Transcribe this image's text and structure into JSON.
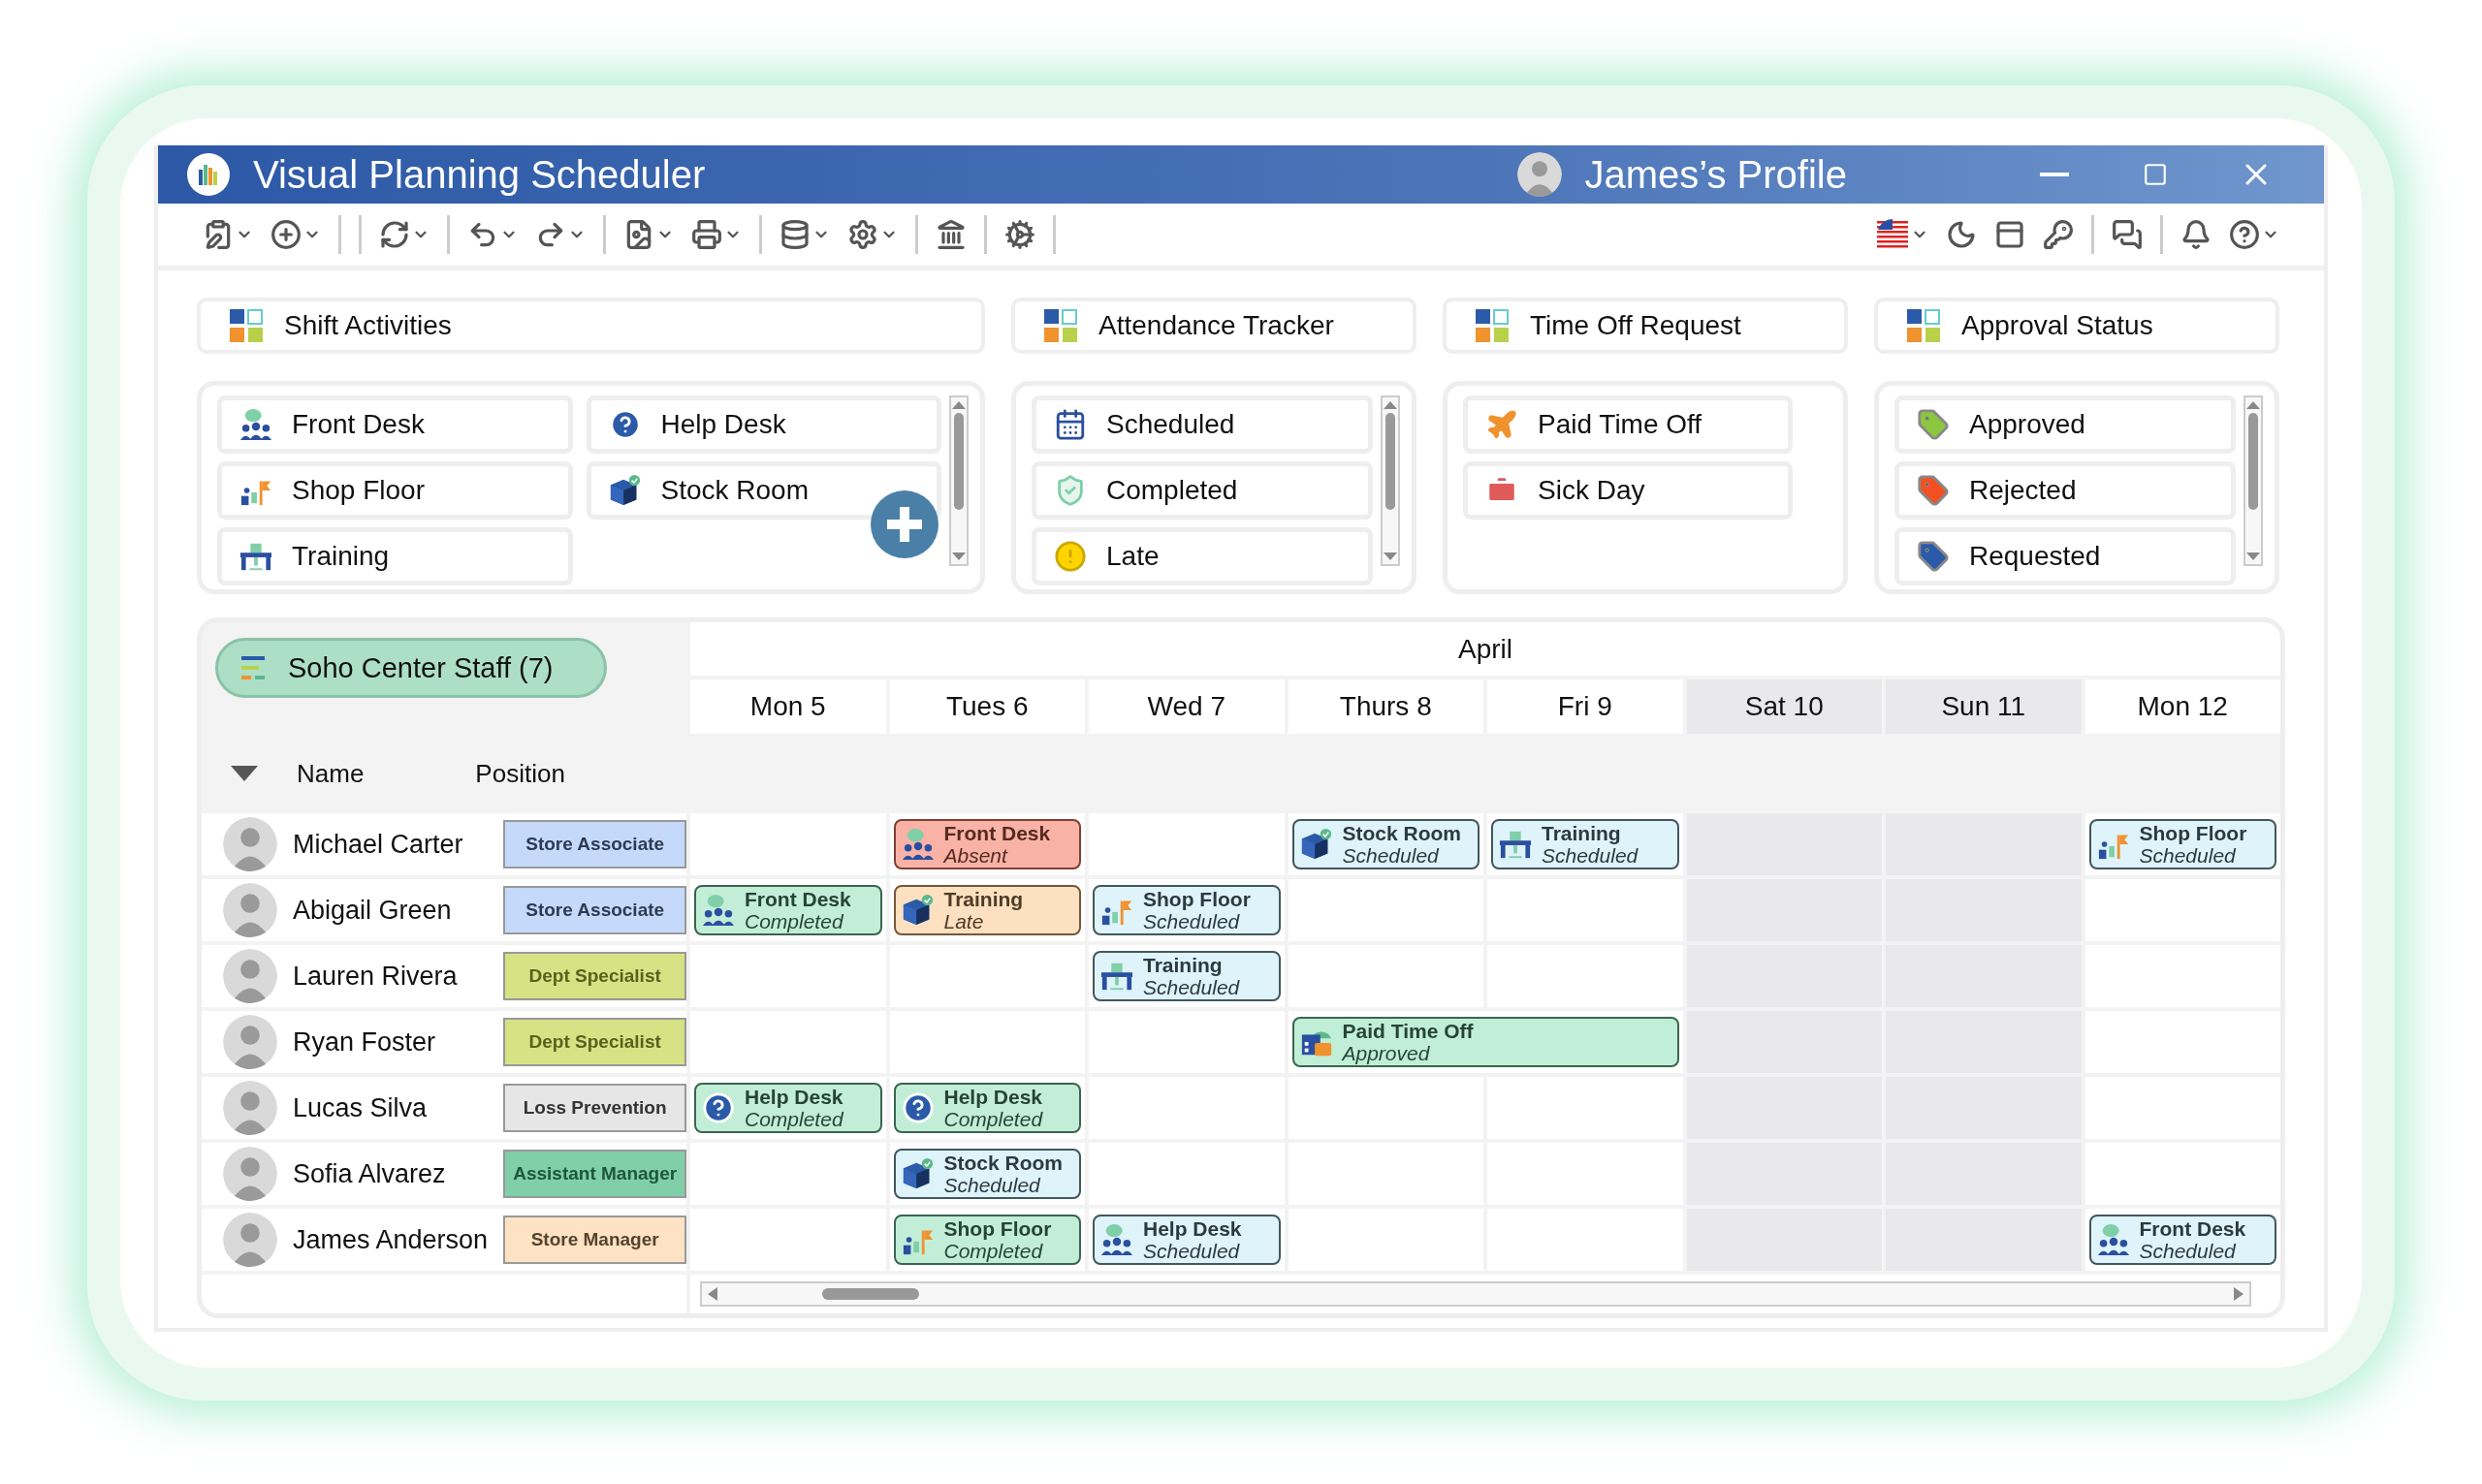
{
  "window": {
    "title": "Visual Planning Scheduler",
    "profile": "James’s Profile"
  },
  "categories": [
    {
      "title": "Shift Activities",
      "scroll": true,
      "items": [
        {
          "label": "Front Desk",
          "kind": "reception"
        },
        {
          "label": "Help Desk",
          "kind": "help"
        },
        {
          "label": "Shop Floor",
          "kind": "floor"
        },
        {
          "label": "Stock Room",
          "kind": "stock"
        },
        {
          "label": "Training",
          "kind": "training"
        }
      ]
    },
    {
      "title": "Attendance Tracker",
      "scroll": true,
      "items": [
        {
          "label": "Scheduled",
          "kind": "calendar"
        },
        {
          "label": "Completed",
          "kind": "shield"
        },
        {
          "label": "Late",
          "kind": "alert"
        }
      ]
    },
    {
      "title": "Time Off Request",
      "scroll": false,
      "items": [
        {
          "label": "Paid Time Off",
          "kind": "plane"
        },
        {
          "label": "Sick Day",
          "kind": "medical"
        }
      ]
    },
    {
      "title": "Approval Status",
      "scroll": true,
      "items": [
        {
          "label": "Approved",
          "kind": "tag",
          "color": "#8cc63f"
        },
        {
          "label": "Rejected",
          "kind": "tag",
          "color": "#f25022"
        },
        {
          "label": "Requested",
          "kind": "tag",
          "color": "#2b5aa8"
        }
      ]
    }
  ],
  "schedule": {
    "group": "Soho Center Staff (7)",
    "month": "April",
    "columns": [
      "Name",
      "Position"
    ],
    "days": [
      {
        "label": "Mon 5",
        "weekend": false
      },
      {
        "label": "Tues 6",
        "weekend": false
      },
      {
        "label": "Wed 7",
        "weekend": false
      },
      {
        "label": "Thurs 8",
        "weekend": false
      },
      {
        "label": "Fri 9",
        "weekend": false
      },
      {
        "label": "Sat 10",
        "weekend": true
      },
      {
        "label": "Sun 11",
        "weekend": true
      },
      {
        "label": "Mon 12",
        "weekend": false
      }
    ],
    "rows": [
      {
        "name": "Michael Carter",
        "position": "Store Associate",
        "color": "#c5d9fb",
        "cells": [
          {},
          {
            "event": {
              "title": "Front Desk",
              "status": "Absent",
              "kind": "reception",
              "color": "#f8b3a6"
            }
          },
          {},
          {
            "event": {
              "title": "Stock Room",
              "status": "Scheduled",
              "kind": "stock",
              "color": "#def3fa"
            }
          },
          {
            "event": {
              "title": "Training",
              "status": "Scheduled",
              "kind": "training",
              "color": "#def3fa"
            }
          },
          {},
          {},
          {
            "event": {
              "title": "Shop Floor",
              "status": "Scheduled",
              "kind": "floor",
              "color": "#def3fa"
            }
          }
        ]
      },
      {
        "name": "Abigail Green",
        "position": "Store Associate",
        "color": "#c5d9fb",
        "cells": [
          {
            "event": {
              "title": "Front Desk",
              "status": "Completed",
              "kind": "reception",
              "color": "#c2eed8"
            }
          },
          {
            "event": {
              "title": "Training",
              "status": "Late",
              "kind": "stock",
              "color": "#fde0c0"
            }
          },
          {
            "event": {
              "title": "Shop Floor",
              "status": "Scheduled",
              "kind": "floor",
              "color": "#def3fa"
            }
          },
          {},
          {},
          {},
          {},
          {}
        ]
      },
      {
        "name": "Lauren Rivera",
        "position": "Dept Specialist",
        "color": "#d6e284",
        "cells": [
          {},
          {},
          {
            "event": {
              "title": "Training",
              "status": "Scheduled",
              "kind": "training",
              "color": "#def3fa"
            }
          },
          {},
          {},
          {},
          {},
          {}
        ]
      },
      {
        "name": "Ryan Foster",
        "position": "Dept Specialist",
        "color": "#d6e284",
        "cells": [
          {},
          {},
          {},
          {
            "event": {
              "title": "Paid Time Off",
              "status": "Approved",
              "kind": "leave",
              "color": "#c0eed6"
            }
          },
          {
            "merged": true
          },
          {},
          {},
          {}
        ]
      },
      {
        "name": "Lucas Silva",
        "position": "Loss Prevention",
        "color": "#e6e6e6",
        "cells": [
          {
            "event": {
              "title": "Help Desk",
              "status": "Completed",
              "kind": "help",
              "color": "#c2eed8"
            }
          },
          {
            "event": {
              "title": "Help Desk",
              "status": "Completed",
              "kind": "help",
              "color": "#c2eed8"
            }
          },
          {},
          {},
          {},
          {},
          {},
          {}
        ]
      },
      {
        "name": "Sofia Alvarez",
        "position": "Assistant Manager",
        "color": "#80cfa9",
        "cells": [
          {},
          {
            "event": {
              "title": "Stock Room",
              "status": "Scheduled",
              "kind": "stock",
              "color": "#def3fa"
            }
          },
          {},
          {},
          {},
          {},
          {},
          {}
        ]
      },
      {
        "name": "James Anderson",
        "position": "Store Manager",
        "color": "#fde2c4",
        "cells": [
          {},
          {
            "event": {
              "title": "Shop Floor",
              "status": "Completed",
              "kind": "floor",
              "color": "#c2eed8"
            }
          },
          {
            "event": {
              "title": "Help Desk",
              "status": "Scheduled",
              "kind": "reception",
              "color": "#def3fa"
            }
          },
          {},
          {},
          {},
          {},
          {
            "event": {
              "title": "Front Desk",
              "status": "Scheduled",
              "kind": "reception",
              "color": "#def3fa"
            }
          }
        ]
      }
    ]
  }
}
